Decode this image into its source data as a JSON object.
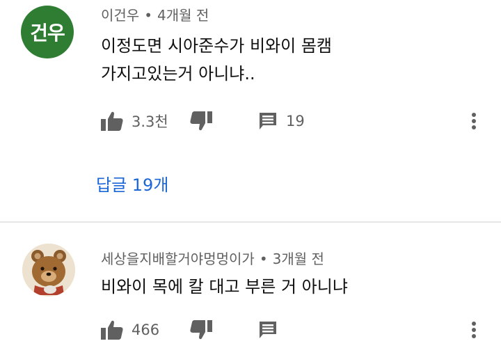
{
  "comments": [
    {
      "avatar_text": "건우",
      "avatar_color": "#2f7d32",
      "author": "이건우",
      "time": "4개월 전",
      "lines": [
        "이정도면 시아준수가 비와이 몸캠",
        "가지고있는거 아니냐.."
      ],
      "likes": "3.3천",
      "reply_count": "19",
      "replies_link": "답글 19개"
    },
    {
      "avatar_image": "teddy-bear",
      "author": "세상을지배할거야멍멍이가",
      "time": "3개월 전",
      "lines": [
        "비와이 목에 칼 대고 부른 거 아니냐"
      ],
      "likes": "466",
      "reply_count": ""
    }
  ],
  "icons": {
    "like": "thumbs-up-icon",
    "dislike": "thumbs-down-icon",
    "reply": "comment-icon",
    "more": "more-vert-icon"
  },
  "colors": {
    "link": "#1a66d6",
    "meta": "#606060",
    "text": "#0f0f0f"
  }
}
